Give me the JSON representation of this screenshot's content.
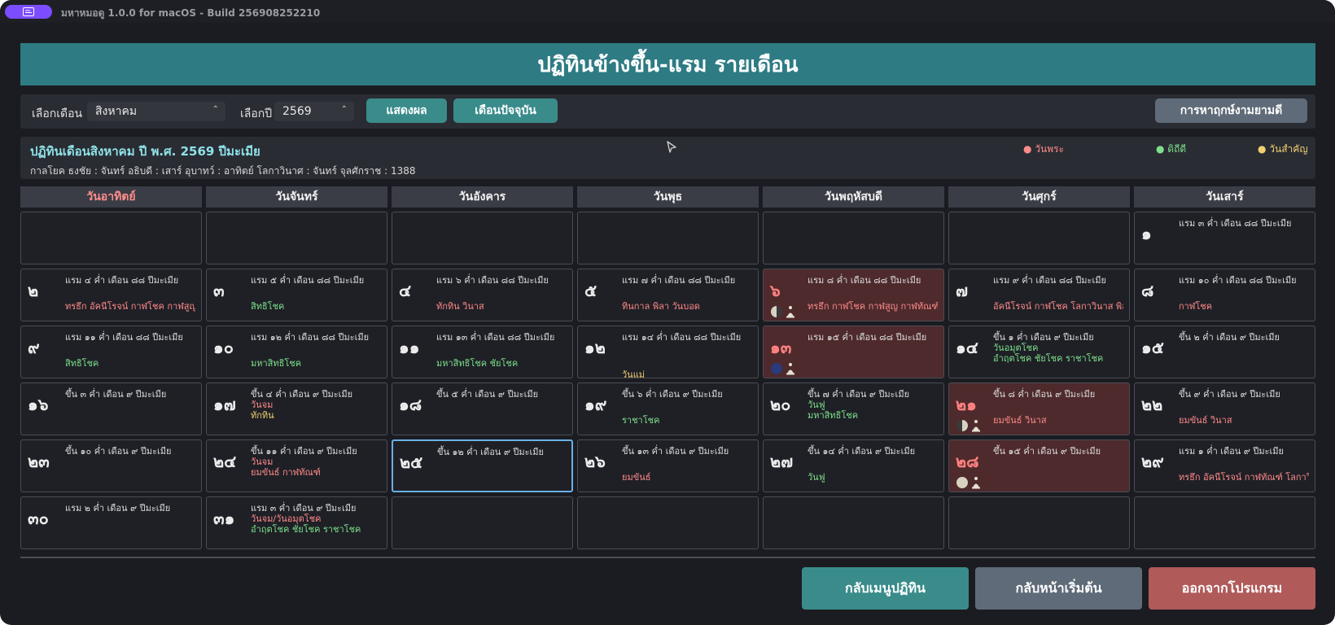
{
  "window": {
    "title": "มหาหมอดู 1.0.0 for macOS - Build 256908252210"
  },
  "header": {
    "title": "ปฏิทินข้างขึ้น-แรม รายเดือน"
  },
  "controls": {
    "month_label": "เลือกเดือน",
    "month_value": "สิงหาคม",
    "year_label": "เลือกปี",
    "year_value": "2569",
    "show_button": "แสดงผล",
    "current_month_button": "เดือนปัจจุบัน",
    "auspicious_button": "การหาฤกษ์งามยามดี"
  },
  "info": {
    "title": "ปฏิทินเดือนสิงหาคม ปี พ.ศ. 2569 ปีมะเมีย",
    "subtitle": "กาลโยค ธงชัย : จันทร์ อธิบดี : เสาร์ อุบาทว์ : อาทิตย์ โลกาวินาศ : จันทร์ จุลศักราช : 1388",
    "legend": [
      {
        "label": "● วันพระ",
        "color": "#ff8a8a"
      },
      {
        "label": "● ดิถีดี",
        "color": "#7ce08a"
      },
      {
        "label": "● วันสำคัญ",
        "color": "#f0d070"
      }
    ]
  },
  "weekdays": [
    "วันอาทิตย์",
    "วันจันทร์",
    "วันอังคาร",
    "วันพุธ",
    "วันพฤหัสบดี",
    "วันศุกร์",
    "วันเสาร์"
  ],
  "days": [
    {
      "num": "๑",
      "lunar": "แรม ๓ ค่ำ เดือน ๘๘ ปีมะเมีย",
      "notes": []
    },
    {
      "num": "๒",
      "lunar": "แรม ๔ ค่ำ เดือน ๘๘ ปีมะเมีย",
      "notes": [
        {
          "text": "ทรธึก อัคนีโรจน์ กาฬโชค กาฬสูญ โล...",
          "color": "red"
        }
      ]
    },
    {
      "num": "๓",
      "lunar": "แรม ๕ ค่ำ เดือน ๘๘ ปีมะเมีย",
      "notes": [
        {
          "text": "สิทธิโชค",
          "color": "green"
        }
      ]
    },
    {
      "num": "๔",
      "lunar": "แรม ๖ ค่ำ เดือน ๘๘ ปีมะเมีย",
      "notes": [
        {
          "text": "ทักทิน วินาส",
          "color": "red"
        }
      ]
    },
    {
      "num": "๕",
      "lunar": "แรม ๗ ค่ำ เดือน ๘๘ ปีมะเมีย",
      "notes": [
        {
          "text": "ทินกาล พิลา วันบอด",
          "color": "red"
        }
      ]
    },
    {
      "num": "๖",
      "lunar": "แรม ๘ ค่ำ เดือน ๘๘ ปีมะเมีย",
      "notes": [
        {
          "text": "ทรธึก กาฬโชค กาฬสูญ กาฬทัณฑ์ โล...",
          "color": "red"
        }
      ]
    },
    {
      "num": "๗",
      "lunar": "แรม ๙ ค่ำ เดือน ๘๘ ปีมะเมีย",
      "notes": [
        {
          "text": "อัคนีโรจน์ กาฬโชค โลกาวินาส พิลา",
          "color": "red"
        }
      ]
    },
    {
      "num": "๘",
      "lunar": "แรม ๑๐ ค่ำ เดือน ๘๘ ปีมะเมีย",
      "notes": [
        {
          "text": "กาฬโชค",
          "color": "red"
        }
      ]
    },
    {
      "num": "๙",
      "lunar": "แรม ๑๑ ค่ำ เดือน ๘๘ ปีมะเมีย",
      "notes": [
        {
          "text": "สิทธิโชค",
          "color": "green"
        }
      ]
    },
    {
      "num": "๑๐",
      "lunar": "แรม ๑๒ ค่ำ เดือน ๘๘ ปีมะเมีย",
      "notes": [
        {
          "text": "มหาสิทธิโชค",
          "color": "green"
        }
      ]
    },
    {
      "num": "๑๑",
      "lunar": "แรม ๑๓ ค่ำ เดือน ๘๘ ปีมะเมีย",
      "notes": [
        {
          "text": "มหาสิทธิโชค ชัยโชค",
          "color": "green"
        }
      ]
    },
    {
      "num": "๑๒",
      "lunar": "แรม ๑๔ ค่ำ เดือน ๘๘ ปีมะเมีย",
      "notes": [
        {
          "text": "วันแม่",
          "color": "yellow"
        }
      ]
    },
    {
      "num": "๑๓",
      "lunar": "แรม ๑๕ ค่ำ เดือน ๘๘ ปีมะเมีย",
      "notes": []
    },
    {
      "num": "๑๔",
      "lunar": "ขึ้น ๑ ค่ำ เดือน ๙ ปีมะเมีย",
      "notes": [
        {
          "text": "วันอมุตโชค",
          "color": "green"
        },
        {
          "text": "อำฤตโชค ชัยโชค ราชาโชค",
          "color": "green"
        }
      ]
    },
    {
      "num": "๑๕",
      "lunar": "ขึ้น ๒ ค่ำ เดือน ๙ ปีมะเมีย",
      "notes": []
    },
    {
      "num": "๑๖",
      "lunar": "ขึ้น ๓ ค่ำ เดือน ๙ ปีมะเมีย",
      "notes": []
    },
    {
      "num": "๑๗",
      "lunar": "ขึ้น ๔ ค่ำ เดือน ๙ ปีมะเมีย",
      "notes": [
        {
          "text": "วันจม",
          "color": "red"
        },
        {
          "text": "ทักทิน",
          "color": "yellow"
        }
      ]
    },
    {
      "num": "๑๘",
      "lunar": "ขึ้น ๕ ค่ำ เดือน ๙ ปีมะเมีย",
      "notes": []
    },
    {
      "num": "๑๙",
      "lunar": "ขึ้น ๖ ค่ำ เดือน ๙ ปีมะเมีย",
      "notes": [
        {
          "text": "ราชาโชค",
          "color": "green"
        }
      ]
    },
    {
      "num": "๒๐",
      "lunar": "ขึ้น ๗ ค่ำ เดือน ๙ ปีมะเมีย",
      "notes": [
        {
          "text": "วันฟู",
          "color": "green"
        },
        {
          "text": "มหาสิทธิโชค",
          "color": "green"
        }
      ]
    },
    {
      "num": "๒๑",
      "lunar": "ขึ้น ๘ ค่ำ เดือน ๙ ปีมะเมีย",
      "notes": [
        {
          "text": "ยมขันธ์ วินาส",
          "color": "red"
        }
      ]
    },
    {
      "num": "๒๒",
      "lunar": "ขึ้น ๙ ค่ำ เดือน ๙ ปีมะเมีย",
      "notes": [
        {
          "text": "ยมขันธ์ วินาส",
          "color": "red"
        }
      ]
    },
    {
      "num": "๒๓",
      "lunar": "ขึ้น ๑๐ ค่ำ เดือน ๙ ปีมะเมีย",
      "notes": []
    },
    {
      "num": "๒๔",
      "lunar": "ขึ้น ๑๑ ค่ำ เดือน ๙ ปีมะเมีย",
      "notes": [
        {
          "text": "วันจม",
          "color": "red"
        },
        {
          "text": "ยมขันธ์ กาฬทัณฑ์",
          "color": "red"
        }
      ]
    },
    {
      "num": "๒๕",
      "lunar": "ขึ้น ๑๒ ค่ำ เดือน ๙ ปีมะเมีย",
      "notes": []
    },
    {
      "num": "๒๖",
      "lunar": "ขึ้น ๑๓ ค่ำ เดือน ๙ ปีมะเมีย",
      "notes": [
        {
          "text": "ยมขันธ์",
          "color": "red"
        }
      ]
    },
    {
      "num": "๒๗",
      "lunar": "ขึ้น ๑๔ ค่ำ เดือน ๙ ปีมะเมีย",
      "notes": [
        {
          "text": "วันฟู",
          "color": "green"
        }
      ]
    },
    {
      "num": "๒๘",
      "lunar": "ขึ้น ๑๕ ค่ำ เดือน ๙ ปีมะเมีย",
      "notes": []
    },
    {
      "num": "๒๙",
      "lunar": "แรม ๑ ค่ำ เดือน ๙ ปีมะเมีย",
      "notes": [
        {
          "text": "ทรธึก อัคนีโรจน์ กาฬทัณฑ์ โลกาวินาส",
          "color": "red"
        }
      ]
    },
    {
      "num": "๓๐",
      "lunar": "แรม ๒ ค่ำ เดือน ๙ ปีมะเมีย",
      "notes": []
    },
    {
      "num": "๓๑",
      "lunar": "แรม ๓ ค่ำ เดือน ๙ ปีมะเมีย",
      "notes": [
        {
          "text": "วันจม/วันอมุตโชค",
          "color": "red"
        },
        {
          "text": "อำฤตโชค ชัยโชค ราชาโชค",
          "color": "green"
        }
      ]
    }
  ],
  "footer": {
    "back_calendar_menu": "กลับเมนูปฏิทิน",
    "back_home": "กลับหน้าเริ่มต้น",
    "exit": "ออกจากโปรแกรม"
  }
}
